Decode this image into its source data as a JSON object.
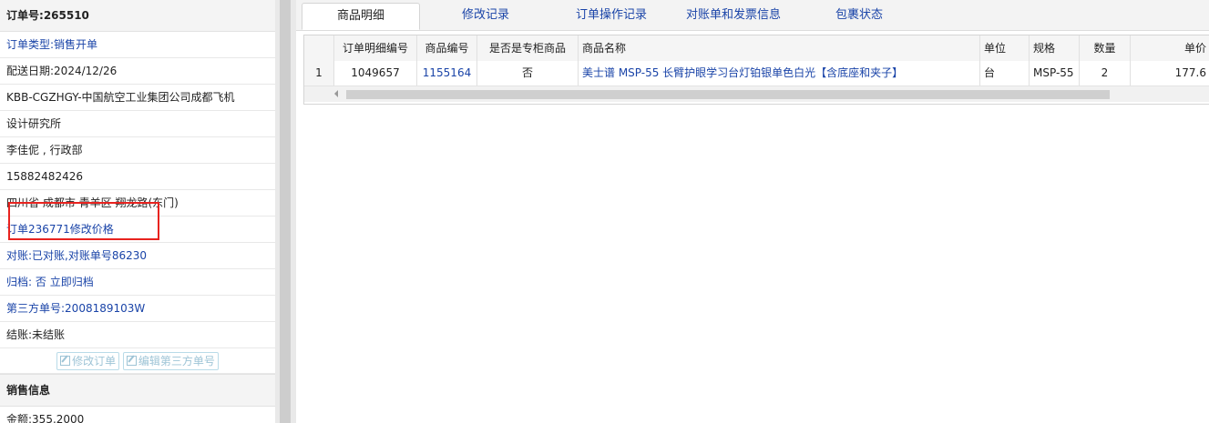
{
  "left": {
    "order_title_label": "订单号:",
    "order_number": "265510",
    "order_type_label": "订单类型:",
    "order_type_value": "销售开单",
    "delivery_date": "配送日期:2024/12/26",
    "company_line1": "KBB-CGZHGY-中国航空工业集团公司成都飞机",
    "company_line2": "设计研究所",
    "contact": "李佳伲 , 行政部",
    "phone": "15882482426",
    "address": "四川省 成都市 青羊区 翔龙路(东门)",
    "order_price_change": "订单236771修改价格",
    "reconcile_label": "对账:",
    "reconcile_value": "已对账,对账单号86230",
    "archive_label": "归档:",
    "archive_value": "否",
    "archive_link": "立即归档",
    "third_party_label": "第三方单号:",
    "third_party_value": "2008189103W",
    "settlement": "结账:未结账",
    "btn_edit_order": "修改订单",
    "btn_edit_third_party": "编辑第三方单号",
    "sales_section": "销售信息",
    "amount": "金额:355.2000"
  },
  "tabs": [
    "商品明细",
    "修改记录",
    "订单操作记录",
    "对账单和发票信息",
    "包裹状态"
  ],
  "grid": {
    "headers": [
      "订单明细编号",
      "商品编号",
      "是否是专柜商品",
      "商品名称",
      "单位",
      "规格",
      "数量",
      "单价"
    ],
    "row": {
      "index": "1",
      "detail_id": "1049657",
      "product_id": "1155164",
      "is_counter": "否",
      "product_name": "美士谱 MSP-55 长臂护眼学习台灯铂银单色白光【含底座和夹子】",
      "unit": "台",
      "spec": "MSP-55",
      "qty": "2",
      "price": "177.6"
    }
  },
  "colors": {
    "link_blue": "#1a44a8",
    "highlight_red": "#e8231f"
  }
}
